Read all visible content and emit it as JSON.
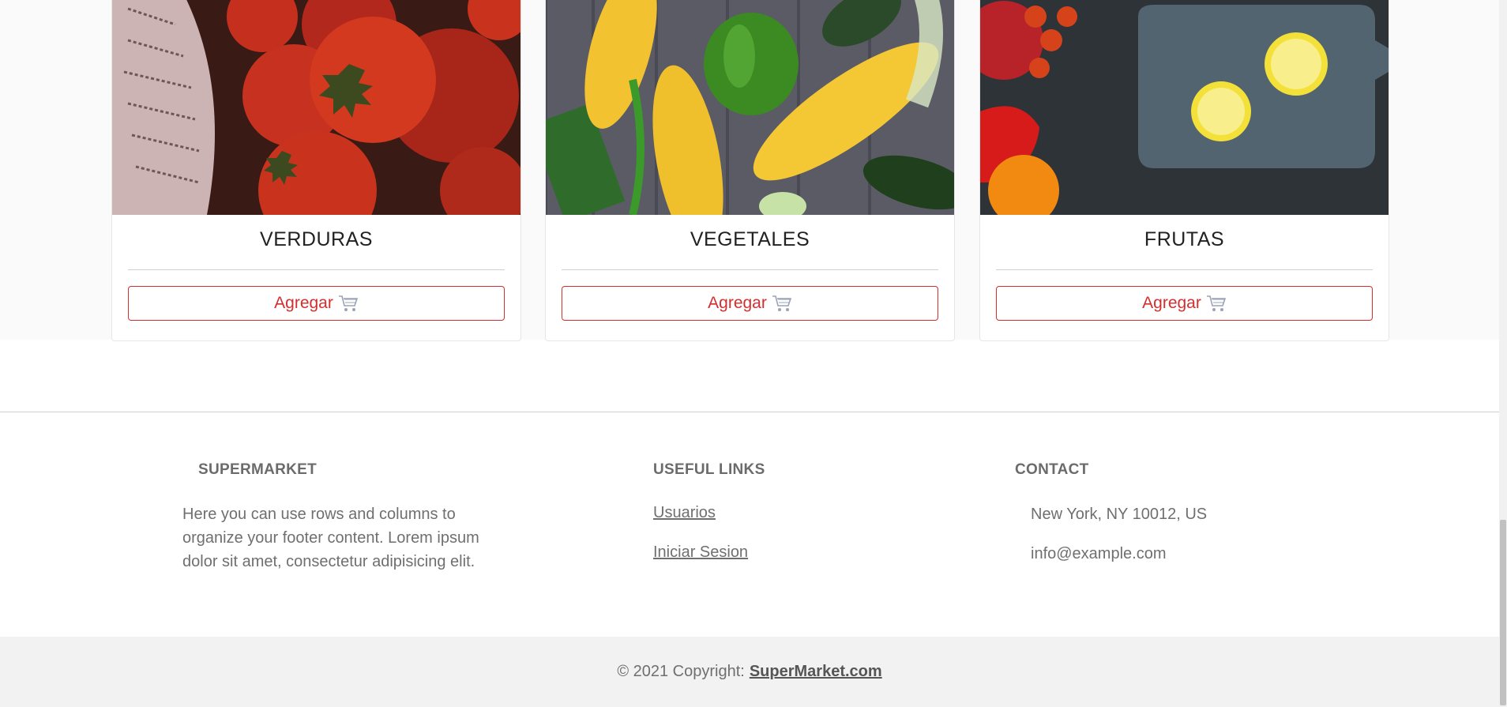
{
  "products": [
    {
      "title": "VERDURAS",
      "button_label": "Agregar",
      "image": "tomatoes-photo"
    },
    {
      "title": "VEGETALES",
      "button_label": "Agregar",
      "image": "corn-pepper-photo"
    },
    {
      "title": "FRUTAS",
      "button_label": "Agregar",
      "image": "lemon-cutting-board-photo"
    }
  ],
  "footer": {
    "brand": {
      "heading": "SUPERMARKET",
      "text": "Here you can use rows and columns to organize your footer content. Lorem ipsum dolor sit amet, consectetur adipisicing elit."
    },
    "links": {
      "heading": "USEFUL LINKS",
      "items": [
        "Usuarios",
        "Iniciar Sesion"
      ]
    },
    "contact": {
      "heading": "CONTACT",
      "address": "New York, NY 10012, US",
      "email": "info@example.com"
    }
  },
  "copyright": {
    "prefix": "© 2021 Copyright:",
    "link": "SuperMarket.com"
  },
  "colors": {
    "accent": "#d32f2f",
    "footer_text": "#6f6f6f",
    "copyright_band": "#f2f2f2"
  },
  "icons": {
    "button_icon": "shopping-cart-icon"
  }
}
